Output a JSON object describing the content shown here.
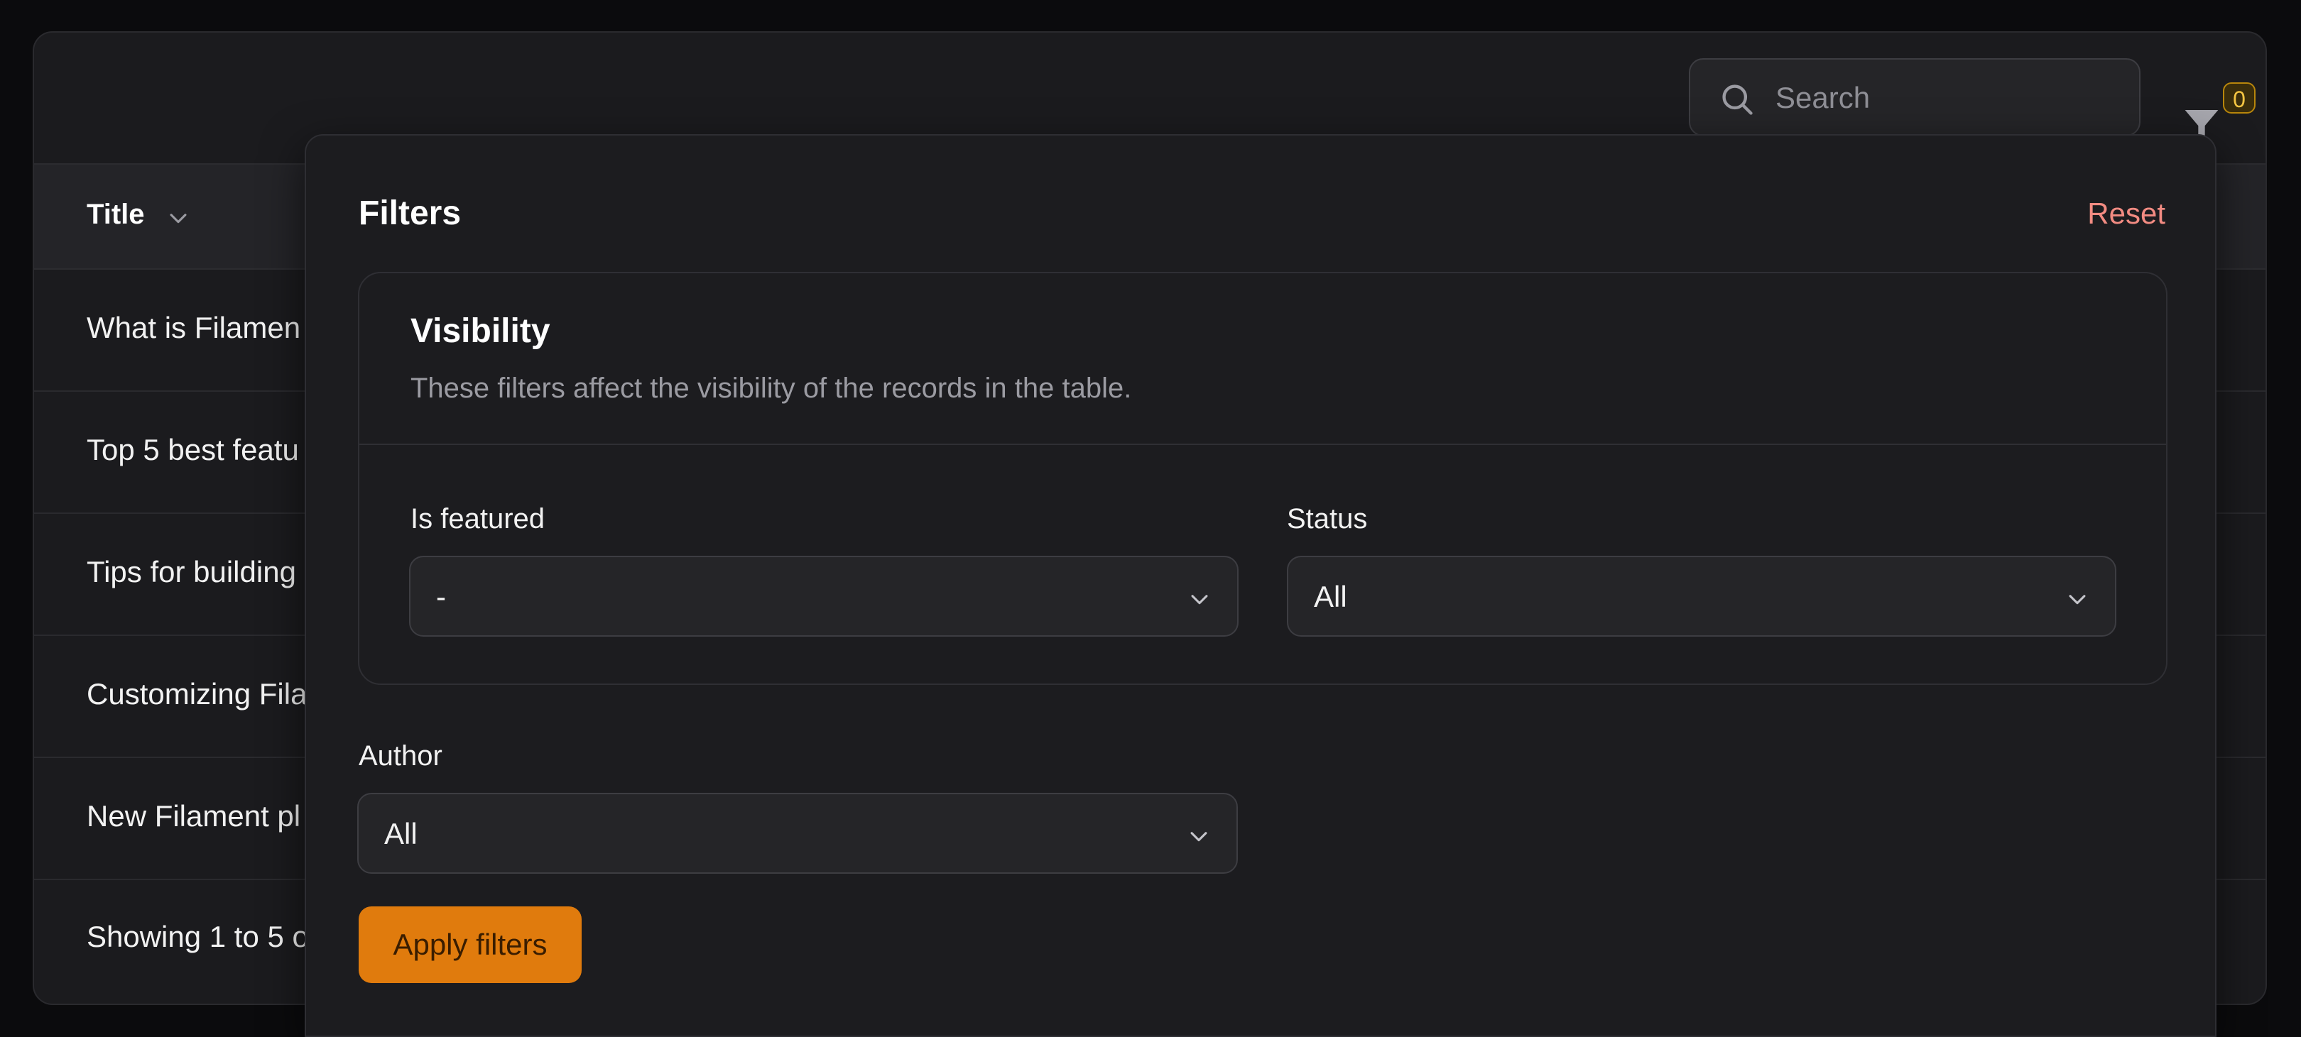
{
  "search": {
    "placeholder": "Search"
  },
  "filter_toggle": {
    "badge_count": "0"
  },
  "table": {
    "column_title": "Title",
    "rows": [
      "What is Filamen",
      "Top 5 best featu",
      "Tips for building",
      "Customizing Fila",
      "New Filament pl"
    ],
    "footer": "Showing 1 to 5 o"
  },
  "filters": {
    "title": "Filters",
    "reset_label": "Reset",
    "visibility_section": {
      "title": "Visibility",
      "description": "These filters affect the visibility of the records in the table.",
      "is_featured": {
        "label": "Is featured",
        "value": "-"
      },
      "status": {
        "label": "Status",
        "value": "All"
      }
    },
    "author": {
      "label": "Author",
      "value": "All"
    },
    "apply_label": "Apply filters"
  }
}
